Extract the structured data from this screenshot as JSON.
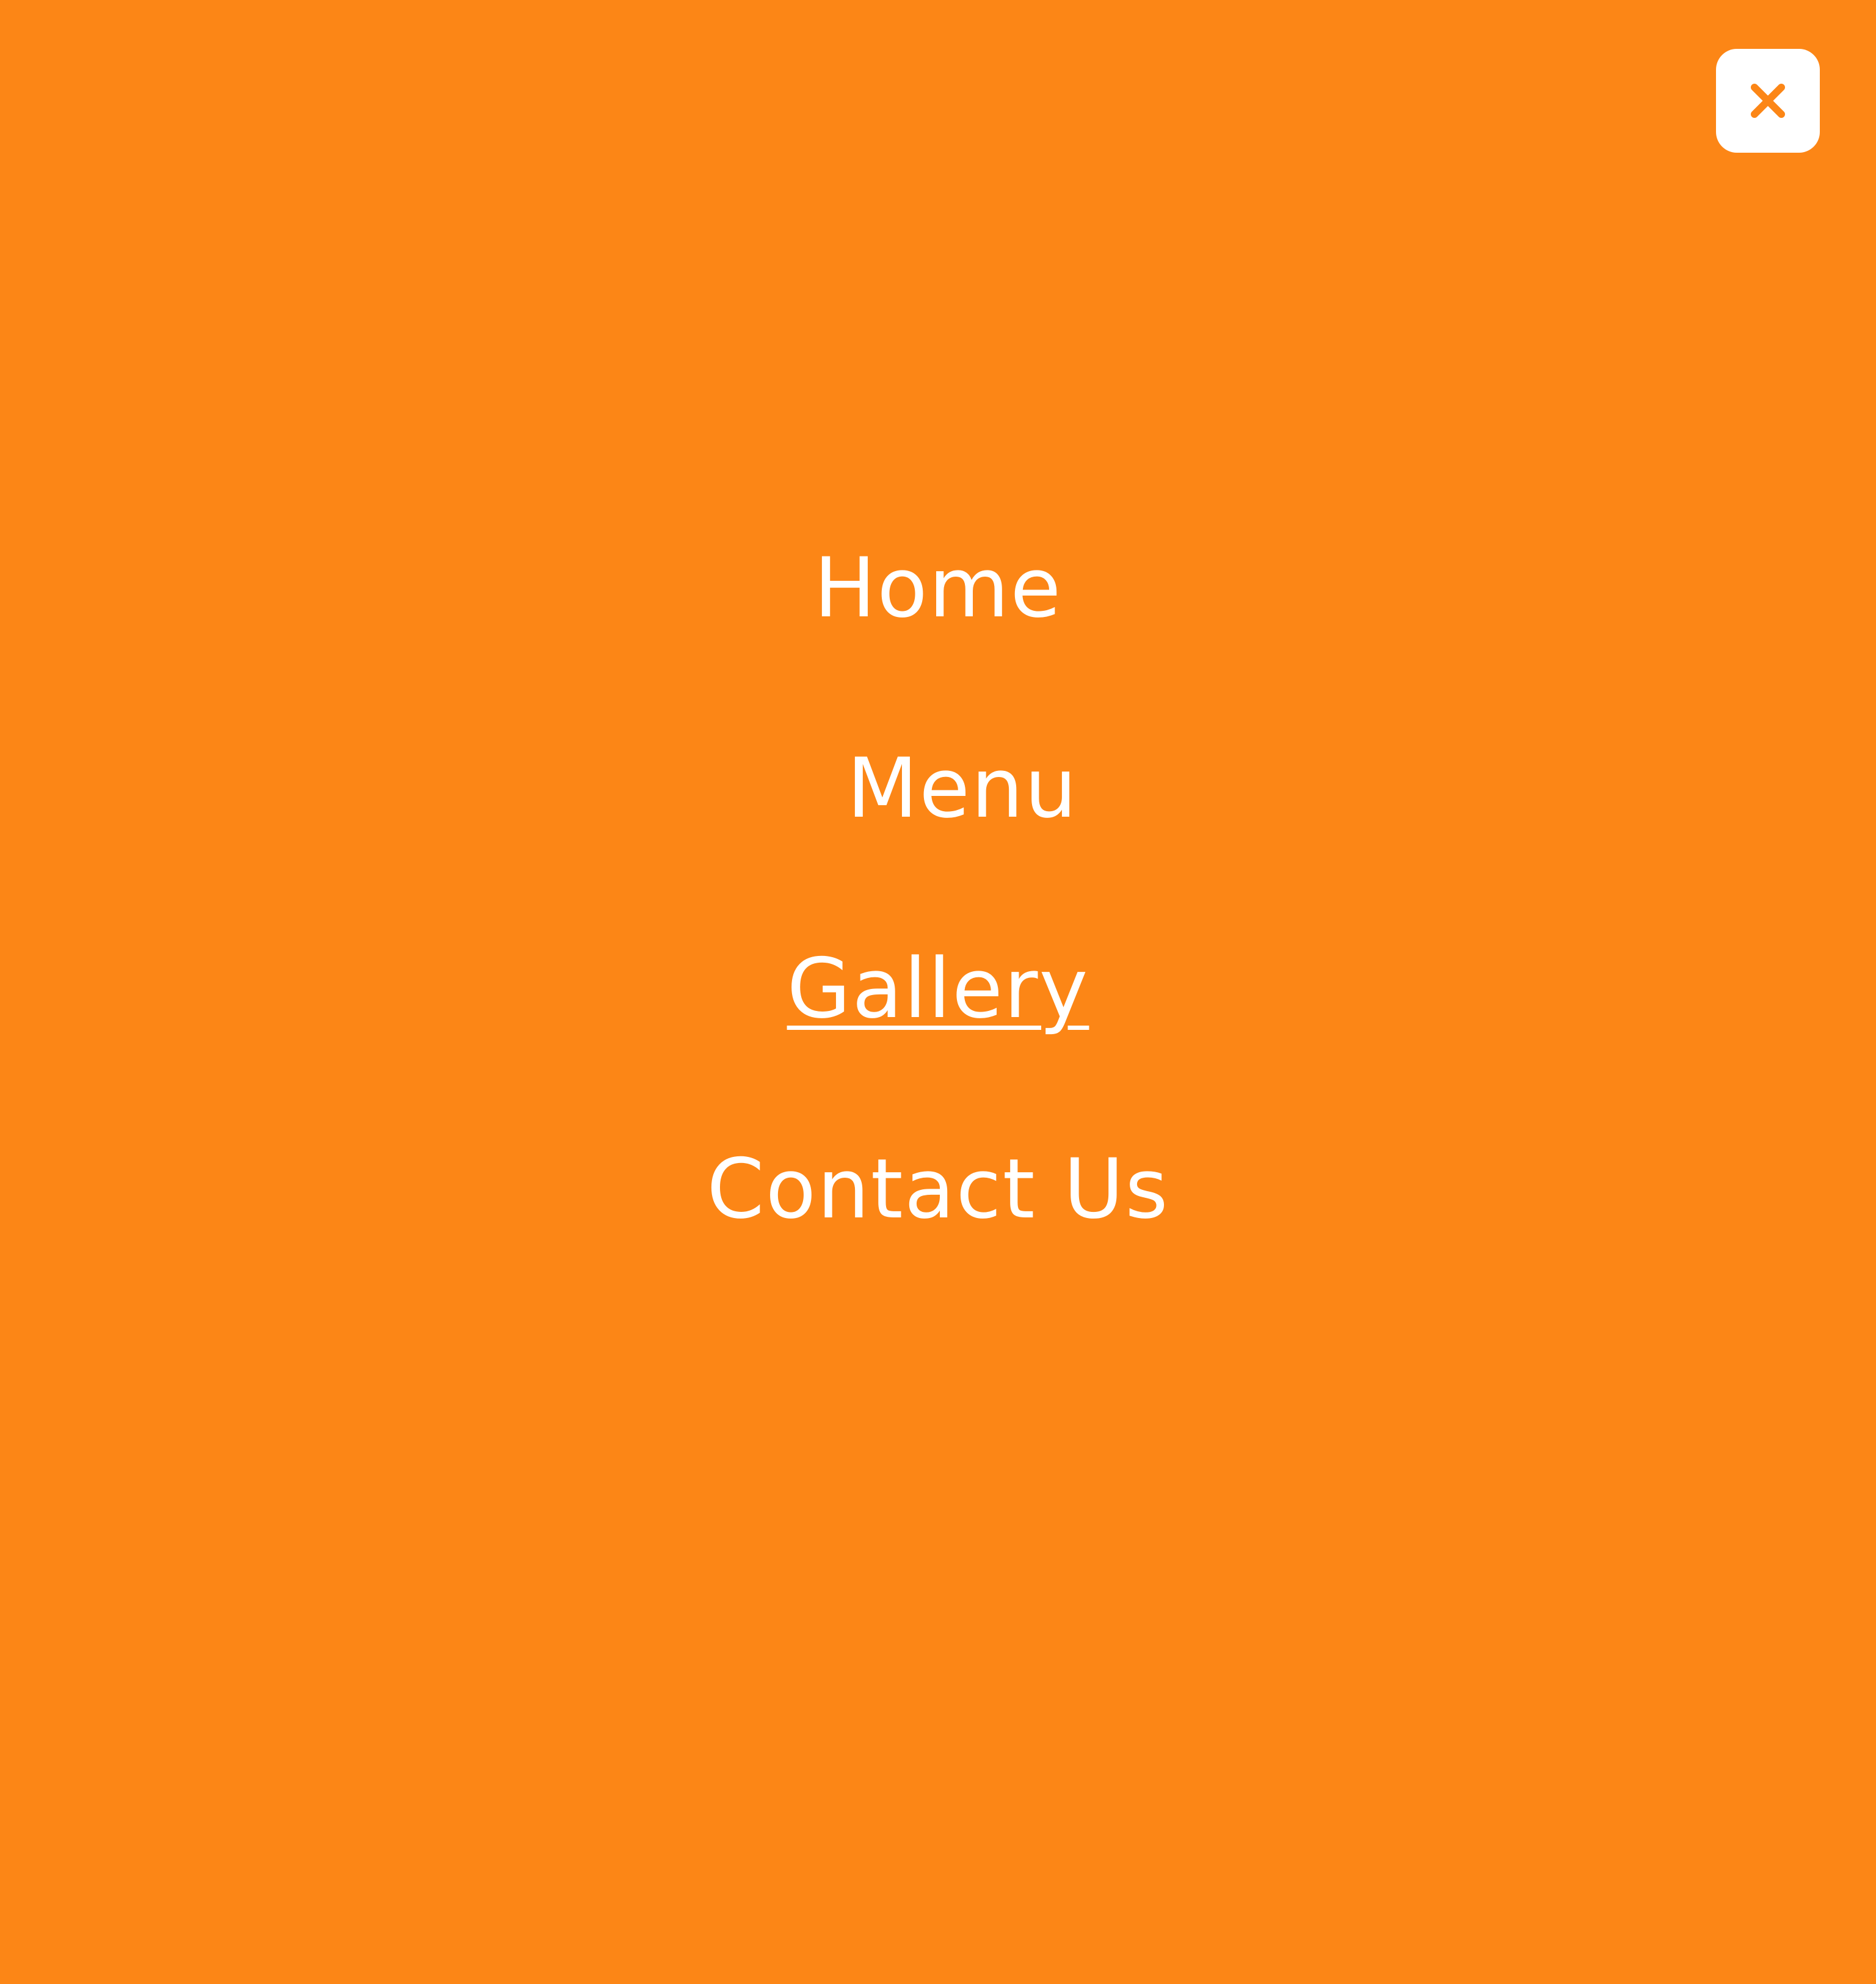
{
  "colors": {
    "background": "#FC8616",
    "text": "#FFFFFF",
    "close_button_bg": "#FFFFFF",
    "close_icon": "#FC8616"
  },
  "close_button": {
    "icon": "close-icon"
  },
  "nav": {
    "items": [
      {
        "label": "Home",
        "active": false
      },
      {
        "label": "Menu",
        "active": false
      },
      {
        "label": "Gallery",
        "active": true
      },
      {
        "label": "Contact Us",
        "active": false
      }
    ]
  }
}
